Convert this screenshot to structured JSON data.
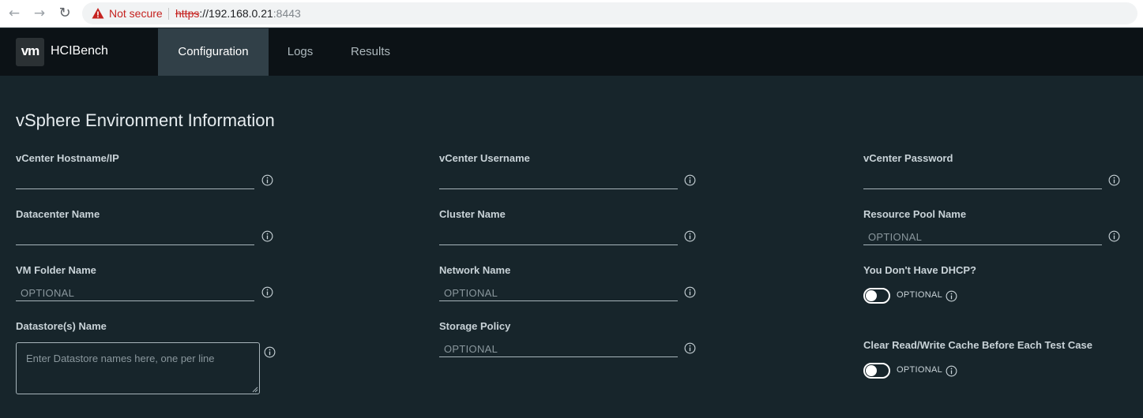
{
  "browser": {
    "not_secure_text": "Not secure",
    "url_scheme": "https",
    "url_host": "://192.168.0.21",
    "url_port": ":8443",
    "warning_color": "#c5221f"
  },
  "app": {
    "logo_text": "vm",
    "title": "HCIBench",
    "tabs": [
      {
        "label": "Configuration",
        "active": true
      },
      {
        "label": "Logs",
        "active": false
      },
      {
        "label": "Results",
        "active": false
      }
    ]
  },
  "form": {
    "section_title": "vSphere Environment Information",
    "fields": {
      "vcenter_hostname": {
        "label": "vCenter Hostname/IP",
        "placeholder": ""
      },
      "vcenter_username": {
        "label": "vCenter Username",
        "placeholder": ""
      },
      "vcenter_password": {
        "label": "vCenter Password",
        "placeholder": ""
      },
      "datacenter_name": {
        "label": "Datacenter Name",
        "placeholder": ""
      },
      "cluster_name": {
        "label": "Cluster Name",
        "placeholder": ""
      },
      "resource_pool_name": {
        "label": "Resource Pool Name",
        "placeholder": "OPTIONAL"
      },
      "vm_folder_name": {
        "label": "VM Folder Name",
        "placeholder": "OPTIONAL"
      },
      "network_name": {
        "label": "Network Name",
        "placeholder": "OPTIONAL"
      },
      "datastore_names": {
        "label": "Datastore(s) Name",
        "placeholder": "Enter Datastore names here, one per line"
      },
      "storage_policy": {
        "label": "Storage Policy",
        "placeholder": "OPTIONAL"
      }
    },
    "toggles": {
      "no_dhcp": {
        "label": "You Don't Have DHCP?",
        "state_text": "OPTIONAL",
        "on": false
      },
      "clear_cache": {
        "label": "Clear Read/Write Cache Before Each Test Case",
        "state_text": "OPTIONAL",
        "on": false
      }
    }
  }
}
